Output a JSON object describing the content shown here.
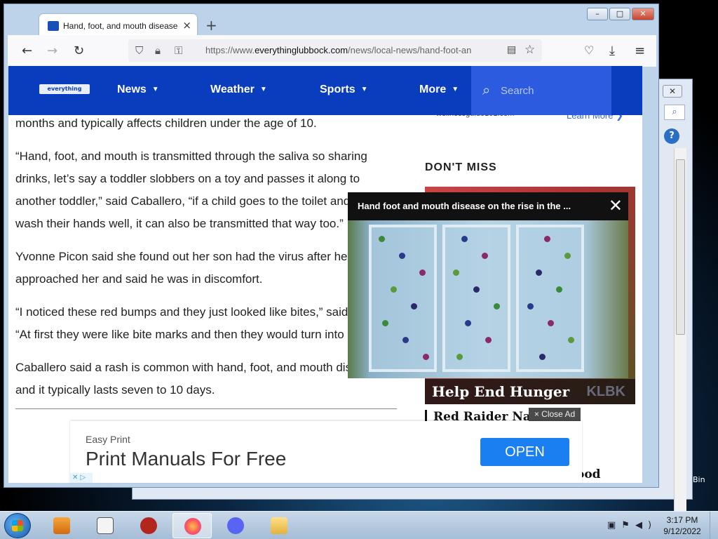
{
  "browser": {
    "tab_title": "Hand, foot, and mouth disease",
    "tab_close": "×",
    "new_tab": "+",
    "url_prefix": "https://www.",
    "url_domain": "everythinglubbock.com",
    "url_suffix": "/news/local-news/hand-foot-an",
    "window_buttons": {
      "minimize": "–",
      "maximize": "□",
      "close": "✕"
    }
  },
  "site": {
    "logo_text": "everything lubbock",
    "nav": [
      {
        "label": "News"
      },
      {
        "label": "Weather"
      },
      {
        "label": "Sports"
      },
      {
        "label": "More"
      }
    ],
    "search_placeholder": "Search"
  },
  "article": {
    "paragraphs": [
      "months and typically affects children under the age of 10.",
      "“Hand, foot, and mouth is transmitted through the saliva so sharing drinks, let’s say a toddler slobbers on a toy and passes it along to another toddler,” said Caballero, “if a child goes to the toilet and doesn’t wash their hands well, it can also be transmitted that way too.”",
      "Yvonne Picon said she found out her son had the virus after he approached her and said he was in discomfort.",
      "“I noticed these red bumps and they just looked like bites,” said Picon. “At first they were like bite marks and then they would turn into",
      "Caballero said a rash is common with hand, foot, and mouth disease and it typically lasts seven to 10 days."
    ]
  },
  "sidebar": {
    "sponsor": "wellnessguide101.com",
    "learn_more": "Learn More ❯",
    "dont_miss": "DON'T MISS",
    "promo_caption": "Help End Hunger",
    "promo_watermark": "KLBK",
    "headline_1": "Red Raider Nation",
    "headline_2_fragment": "ood"
  },
  "video_popup": {
    "title": "Hand foot and mouth disease on the rise in the ...",
    "close": "✕"
  },
  "ad": {
    "close_ad": "× Close Ad",
    "brand": "Easy Print",
    "headline": "Print Manuals For Free",
    "cta": "OPEN"
  },
  "taskbar": {
    "time": "3:17 PM",
    "date": "9/12/2022"
  },
  "desktop": {
    "recycle_bin_label": "Bin"
  }
}
